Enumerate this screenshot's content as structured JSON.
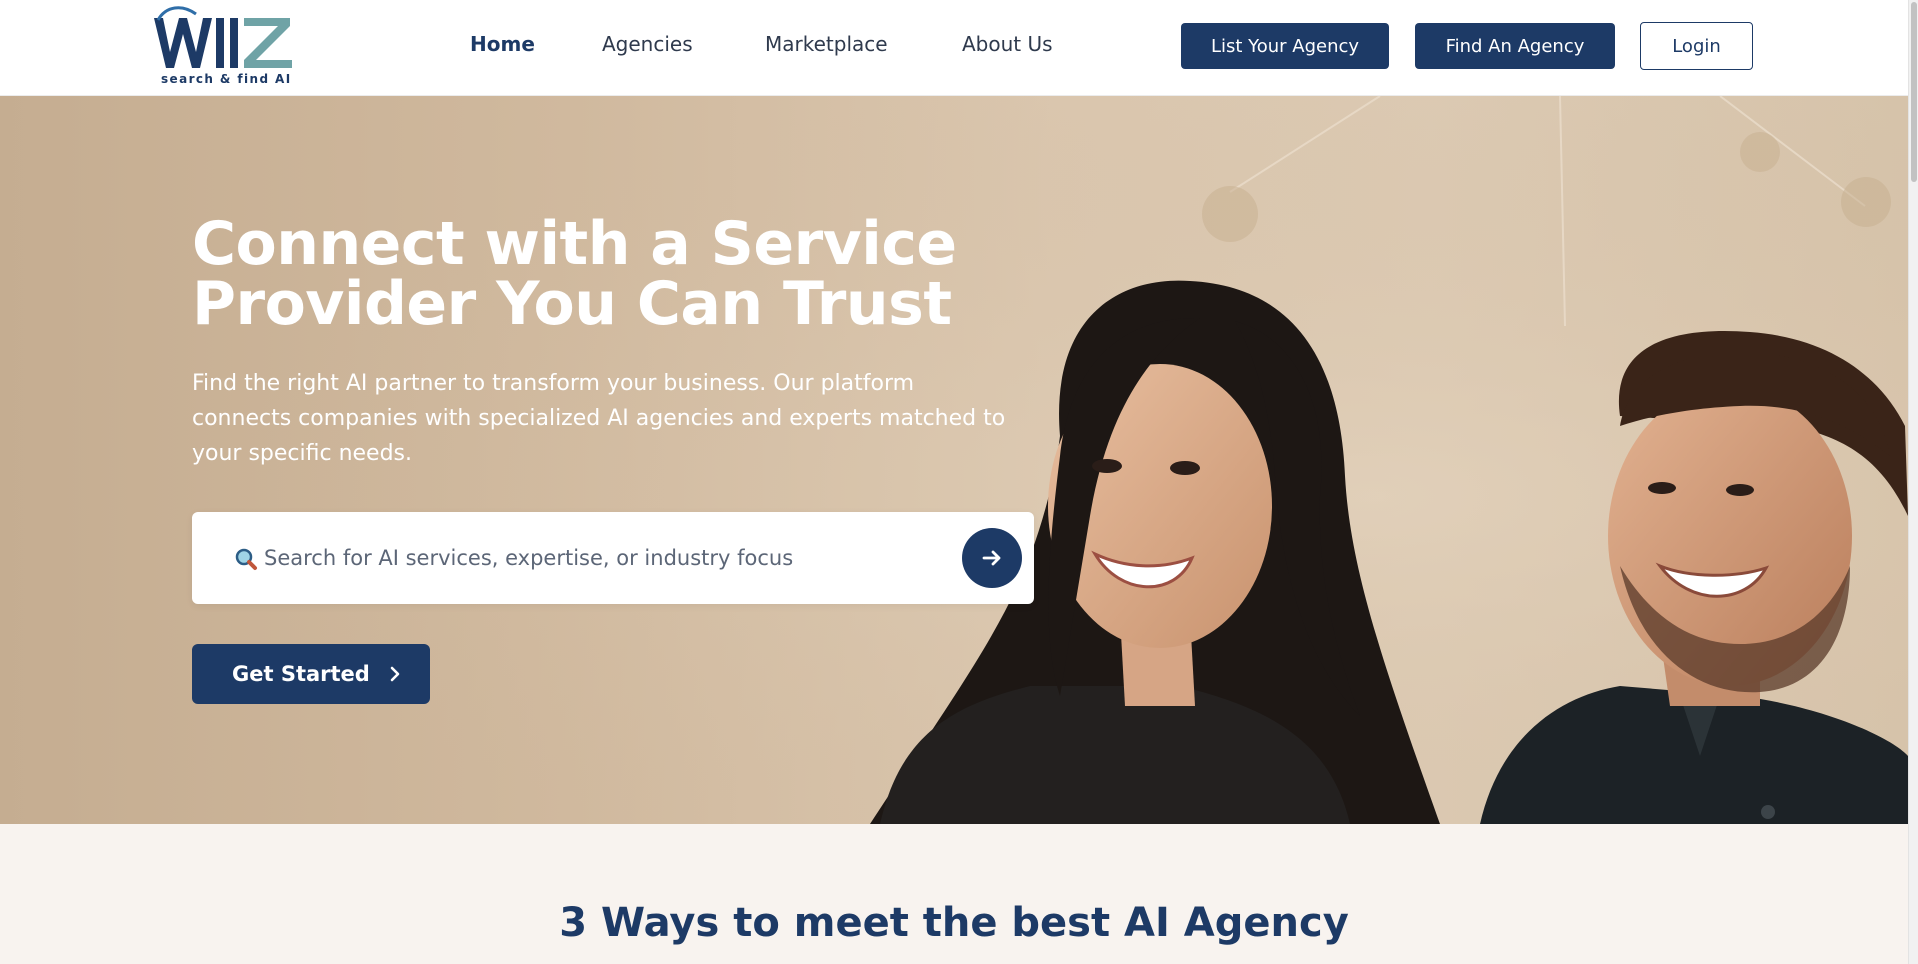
{
  "brand": {
    "logo_text": "WIIZ",
    "tagline": "search & find AI",
    "colors": {
      "primary": "#1d3a66",
      "accent": "#6fa3a6"
    }
  },
  "nav": {
    "links": [
      {
        "label": "Home",
        "active": true
      },
      {
        "label": "Agencies"
      },
      {
        "label": "Marketplace"
      },
      {
        "label": "About Us"
      }
    ]
  },
  "header_buttons": {
    "list_agency": "List Your Agency",
    "find_agency": "Find An Agency",
    "login": "Login"
  },
  "hero": {
    "title_line1": "Connect with a Service",
    "title_line2": "Provider You Can Trust",
    "subtitle_line1": "Find the right AI partner to transform your business. Our platform",
    "subtitle_line2": "connects companies with specialized AI agencies and experts matched to",
    "subtitle_line3": "your specific needs.",
    "search": {
      "placeholder": "Search for AI services, expertise, or industry focus",
      "icon": "magnifier-icon",
      "submit_icon": "arrow-right-icon"
    },
    "cta_label": "Get Started",
    "cta_icon": "chevron-right-icon",
    "image": "photo of smiling woman and man in business attire"
  },
  "section": {
    "title": "3 Ways to meet the best AI Agency"
  }
}
